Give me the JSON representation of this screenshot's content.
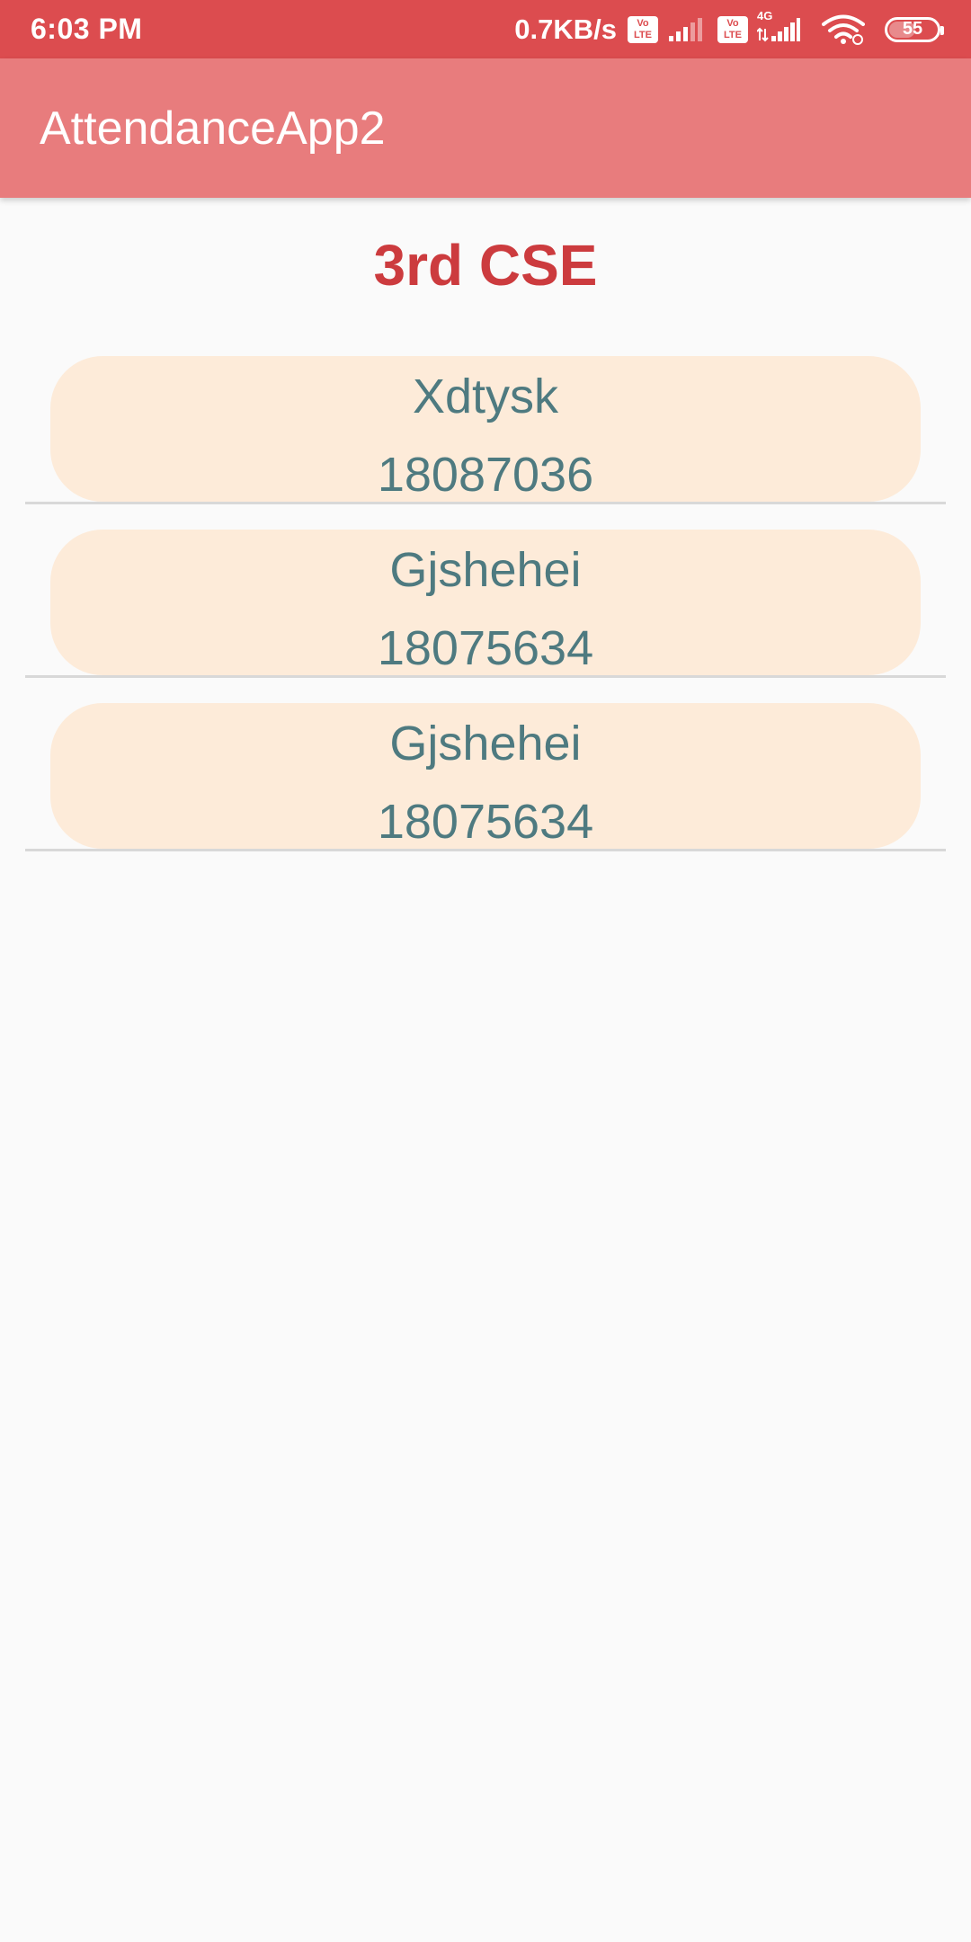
{
  "status_bar": {
    "time": "6:03 PM",
    "net_speed": "0.7KB/s",
    "volte_label_top": "Vo",
    "volte_label_bottom": "LTE",
    "network_type": "4G",
    "battery_level": "55",
    "battery_fraction": 0.55
  },
  "app_bar": {
    "title": "AttendanceApp2",
    "background_color": "#e87c7d"
  },
  "class_heading": "3rd CSE",
  "students": [
    {
      "name": "Xdtysk",
      "id": "18087036"
    },
    {
      "name": "Gjshehei",
      "id": "18075634"
    },
    {
      "name": "Gjshehei",
      "id": "18075634"
    }
  ],
  "colors": {
    "status_bar": "#dc4c4f",
    "heading": "#cc3b3e",
    "card_background": "#fdebd9",
    "card_text": "#4e7a80"
  }
}
